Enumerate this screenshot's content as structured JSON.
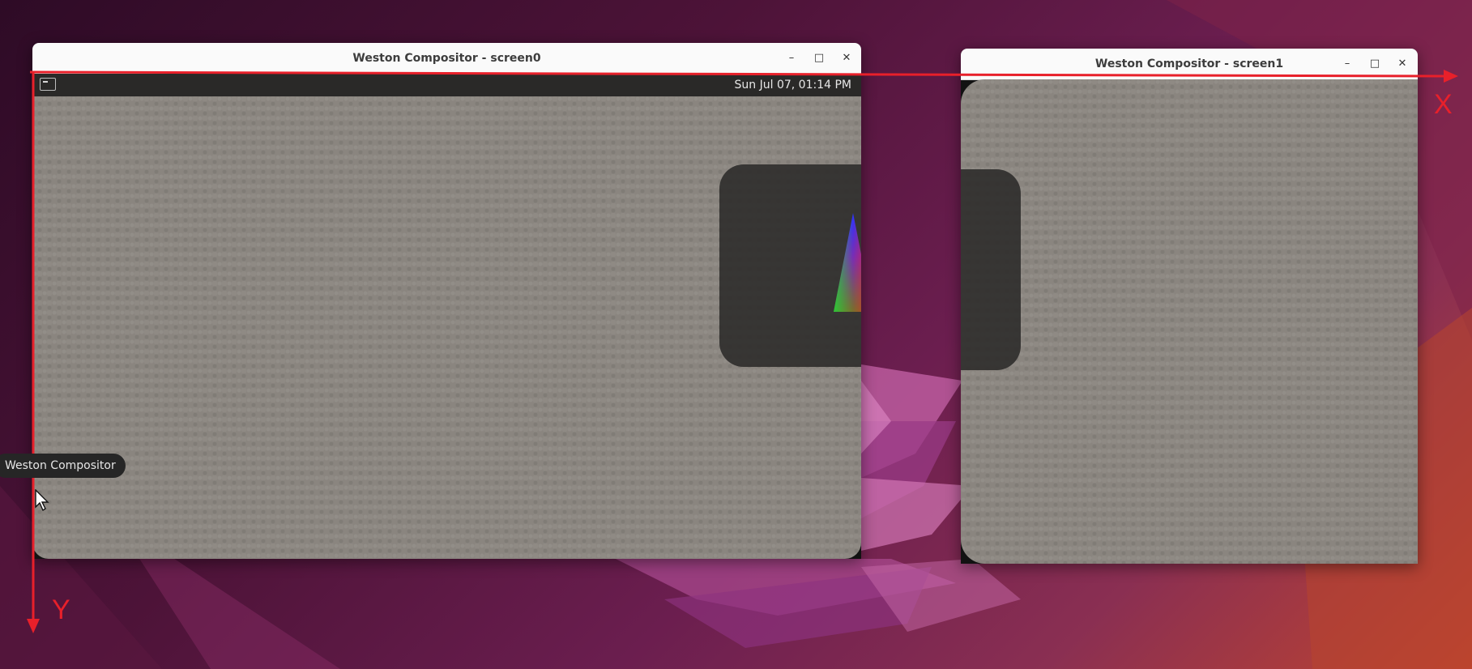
{
  "colors": {
    "wallpaper_dark": "#2e0b26",
    "wallpaper_light": "#c0442f",
    "titlebar": "#fafafa",
    "panel": "#2a2928",
    "content_gray": "#8a857f",
    "axis_red": "#e8202a"
  },
  "windows": [
    {
      "title": "Weston Compositor - screen0",
      "controls": {
        "minimize": "–",
        "maximize": "□",
        "close": "✕"
      },
      "panel": {
        "launcher_icon": "terminal-icon",
        "clock": "Sun Jul 07, 01:14 PM"
      }
    },
    {
      "title": "Weston Compositor - screen1",
      "controls": {
        "minimize": "–",
        "maximize": "□",
        "close": "✕"
      }
    }
  ],
  "tooltip": {
    "text": "Weston Compositor"
  },
  "axes": {
    "x_label": "X",
    "y_label": "Y"
  },
  "cursor_icon": "mouse-pointer-icon"
}
